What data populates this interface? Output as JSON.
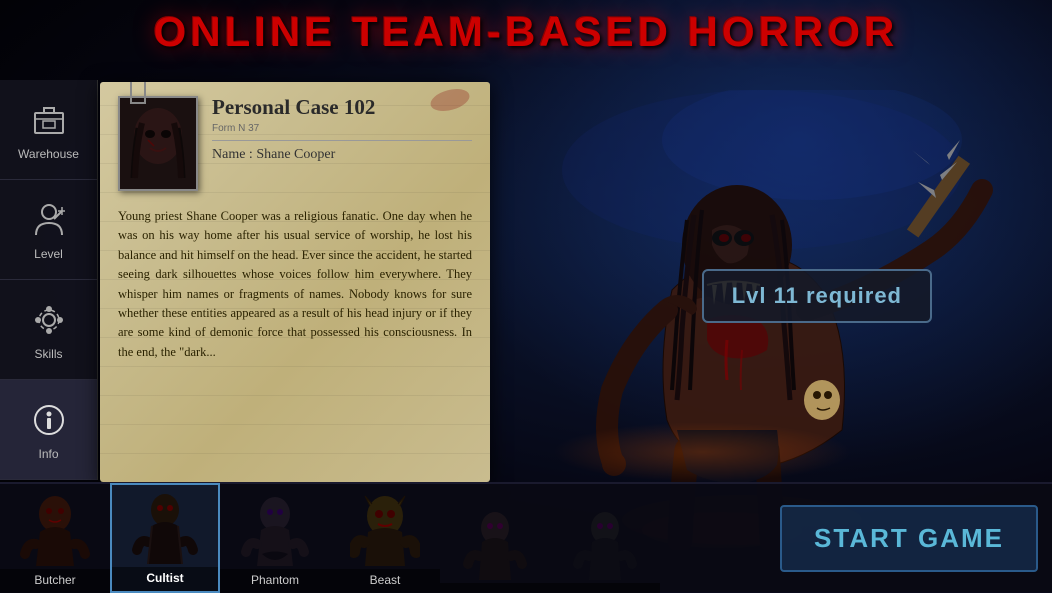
{
  "title": "ONLINE TEAM-BASED HORROR",
  "sidebar": {
    "items": [
      {
        "id": "warehouse",
        "label": "Warehouse",
        "icon": "box-icon"
      },
      {
        "id": "level",
        "label": "Level",
        "icon": "person-icon"
      },
      {
        "id": "skills",
        "label": "Skills",
        "icon": "gear-icon"
      },
      {
        "id": "info",
        "label": "Info",
        "icon": "info-icon",
        "active": true
      }
    ]
  },
  "case_card": {
    "title": "Personal Case 102",
    "form_number": "Form N 37",
    "name_label": "Name : Shane Cooper",
    "body_text": "Young priest Shane Cooper was a religious fanatic. One day when he was on his way home after his usual service of worship, he lost his balance and hit himself on the head. Ever since the accident, he started seeing dark silhouettes whose voices follow him everywhere. They whisper him names or fragments of names. Nobody knows for sure whether these entities appeared as a result of his head injury or if they are some kind of demonic force that possessed his consciousness. In the end, the \"dark..."
  },
  "level_badge": {
    "text": "Lvl 11 required"
  },
  "characters": [
    {
      "id": "butcher",
      "label": "Butcher",
      "active": false
    },
    {
      "id": "cultist",
      "label": "Cultist",
      "active": true
    },
    {
      "id": "phantom",
      "label": "Phantom",
      "active": false
    },
    {
      "id": "beast",
      "label": "Beast",
      "active": false
    },
    {
      "id": "slot5",
      "label": "",
      "active": false
    },
    {
      "id": "slot6",
      "label": "",
      "active": false
    }
  ],
  "start_button_label": "START GAME",
  "colors": {
    "title_red": "#cc0000",
    "sidebar_bg": "#141418",
    "card_bg": "#c8bc8e",
    "badge_color": "#7eb8d4",
    "start_btn_color": "#5ab8d8"
  }
}
